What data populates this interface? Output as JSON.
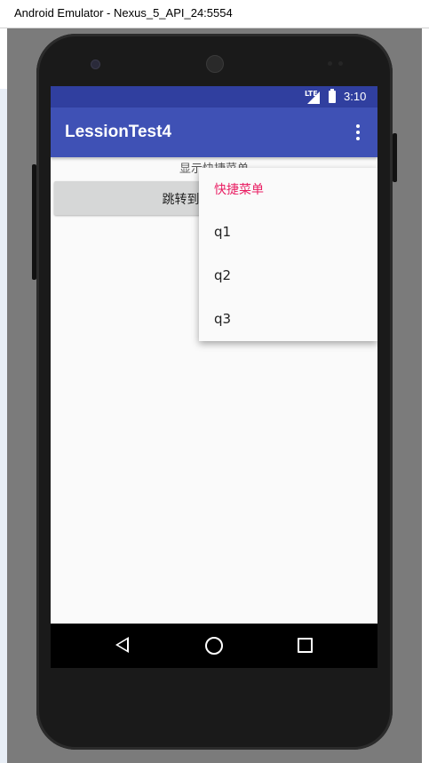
{
  "window": {
    "title": "Android Emulator - Nexus_5_API_24:5554"
  },
  "status_bar": {
    "network": "LTE",
    "time": "3:10"
  },
  "app_bar": {
    "title": "LessionTest4"
  },
  "content": {
    "label": "显示快捷菜单",
    "button_label": "跳转到"
  },
  "popup_menu": {
    "header": "快捷菜单",
    "items": [
      {
        "label": "q1"
      },
      {
        "label": "q2"
      },
      {
        "label": "q3"
      }
    ]
  },
  "colors": {
    "status_bar": "#303f9f",
    "app_bar": "#3f51b5",
    "menu_header": "#e91e63"
  }
}
